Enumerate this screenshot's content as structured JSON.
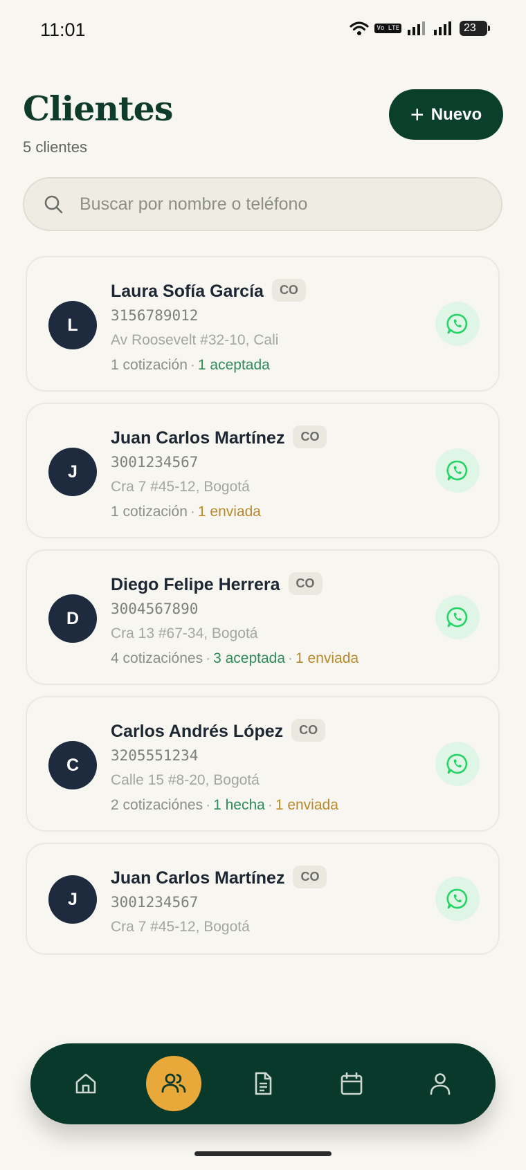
{
  "status": {
    "time": "11:01",
    "battery": "23",
    "volte": "Vo LTE"
  },
  "header": {
    "title": "Clientes",
    "subtitle": "5 clientes",
    "new_button": "Nuevo"
  },
  "search": {
    "placeholder": "Buscar por nombre o teléfono",
    "value": ""
  },
  "clients": [
    {
      "initial": "L",
      "name": "Laura Sofía García",
      "country": "CO",
      "phone": "3156789012",
      "address": "Av Roosevelt #32-10, Cali",
      "summary": {
        "count": "1 cotización",
        "accepted": "1 aceptada"
      }
    },
    {
      "initial": "J",
      "name": "Juan Carlos Martínez",
      "country": "CO",
      "phone": "3001234567",
      "address": "Cra 7 #45-12, Bogotá",
      "summary": {
        "count": "1 cotización",
        "sent": "1 enviada"
      }
    },
    {
      "initial": "D",
      "name": "Diego Felipe Herrera",
      "country": "CO",
      "phone": "3004567890",
      "address": "Cra 13 #67-34, Bogotá",
      "summary": {
        "count": "4 cotizaciónes",
        "accepted": "3 aceptada",
        "sent": "1 enviada"
      }
    },
    {
      "initial": "C",
      "name": "Carlos Andrés López",
      "country": "CO",
      "phone": "3205551234",
      "address": "Calle 15 #8-20, Bogotá",
      "summary": {
        "count": "2 cotizaciónes",
        "done": "1 hecha",
        "sent": "1 enviada"
      }
    },
    {
      "initial": "J",
      "name": "Juan Carlos Martínez",
      "country": "CO",
      "phone": "3001234567",
      "address": "Cra 7 #45-12, Bogotá"
    }
  ],
  "nav": {
    "items": [
      "home-icon",
      "clients-icon",
      "document-icon",
      "calendar-icon",
      "profile-icon"
    ],
    "active": "clients-icon",
    "colors": {
      "bar": "#08392a",
      "active": "#e8a93a",
      "whatsapp": "#25d366"
    }
  }
}
